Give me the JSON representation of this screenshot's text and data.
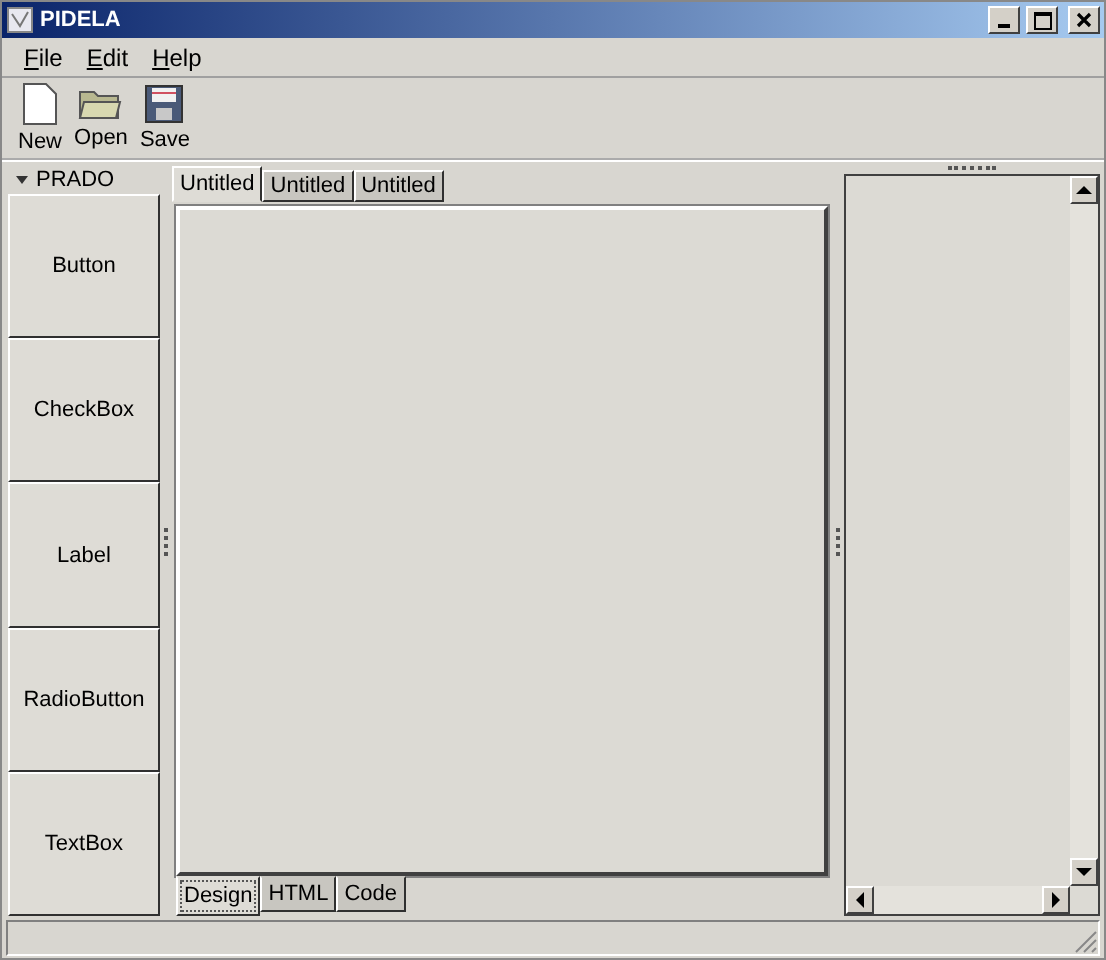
{
  "window": {
    "title": "PIDELA"
  },
  "menu": [
    "File",
    "Edit",
    "Help"
  ],
  "toolbar": [
    {
      "kind": "new",
      "label": "New"
    },
    {
      "kind": "open",
      "label": "Open"
    },
    {
      "kind": "save",
      "label": "Save"
    }
  ],
  "palette": {
    "title": "PRADO",
    "expanded": true,
    "items": [
      "Button",
      "CheckBox",
      "Label",
      "RadioButton",
      "TextBox"
    ]
  },
  "document_tabs": [
    {
      "label": "Untitled",
      "selected": true
    },
    {
      "label": "Untitled",
      "selected": false
    },
    {
      "label": "Untitled",
      "selected": false
    }
  ],
  "view_tabs": [
    {
      "label": "Design",
      "selected": true
    },
    {
      "label": "HTML",
      "selected": false
    },
    {
      "label": "Code",
      "selected": false
    }
  ]
}
